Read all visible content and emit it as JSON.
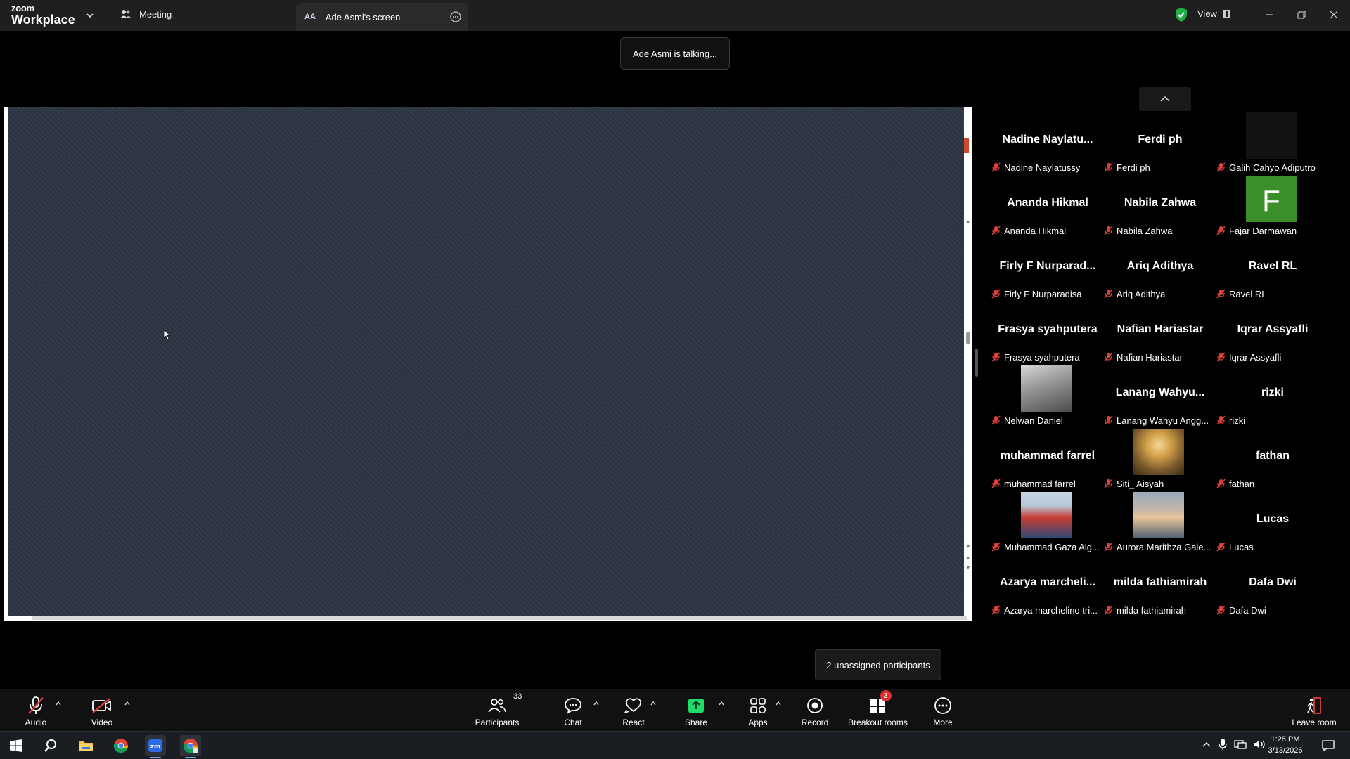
{
  "app": {
    "brand_line1": "zoom",
    "brand_line2": "Workplace",
    "tabs": [
      {
        "label": "Meeting"
      },
      {
        "label": "Ade Asmi's screen",
        "badge": "AA"
      }
    ],
    "view_label": "View"
  },
  "status": {
    "talking": "Ade Asmi is talking...",
    "unassigned": "2 unassigned participants"
  },
  "participants": [
    {
      "big": "Nadine  Naylatu...",
      "name": "Nadine Naylatussy",
      "muted": true
    },
    {
      "big": "Ferdi ph",
      "name": "Ferdi ph",
      "muted": true
    },
    {
      "big": "",
      "name": "Galih Cahyo Adiputro",
      "muted": true,
      "thumb": "dark"
    },
    {
      "big": "Ananda Hikmal",
      "name": "Ananda Hikmal",
      "muted": true
    },
    {
      "big": "Nabila Zahwa",
      "name": "Nabila Zahwa",
      "muted": true
    },
    {
      "big": "",
      "name": "Fajar Darmawan",
      "muted": true,
      "thumb": "avatar",
      "initial": "F"
    },
    {
      "big": "Firly  F  Nurparad...",
      "name": "Firly F Nurparadisa",
      "muted": true
    },
    {
      "big": "Ariq Adithya",
      "name": "Ariq Adithya",
      "muted": true
    },
    {
      "big": "Ravel RL",
      "name": "Ravel RL",
      "muted": true
    },
    {
      "big": "Frasya syahputera",
      "name": "Frasya syahputera",
      "muted": true
    },
    {
      "big": "Nafian Hariastar",
      "name": "Nafian Hariastar",
      "muted": true
    },
    {
      "big": "Iqrar Assyafli",
      "name": "Iqrar Assyafli",
      "muted": true
    },
    {
      "big": "",
      "name": "Nelwan Daniel",
      "muted": true,
      "thumb": "photo-gray"
    },
    {
      "big": "Lanang  Wahyu...",
      "name": "Lanang Wahyu Angg...",
      "muted": true
    },
    {
      "big": "rizki",
      "name": "rizki",
      "muted": true
    },
    {
      "big": "muhammad farrel",
      "name": "muhammad farrel",
      "muted": true
    },
    {
      "big": "",
      "name": "Siti_ Aisyah",
      "muted": true,
      "thumb": "photo-sunset"
    },
    {
      "big": "fathan",
      "name": "fathan",
      "muted": true
    },
    {
      "big": "",
      "name": "Muhammad Gaza Alg...",
      "muted": true,
      "thumb": "photo-person"
    },
    {
      "big": "",
      "name": "Aurora Marithza Gale...",
      "muted": true,
      "thumb": "photo-sky"
    },
    {
      "big": "Lucas",
      "name": "Lucas",
      "muted": true
    },
    {
      "big": "Azarya  marcheli...",
      "name": "Azarya marchelino tri...",
      "muted": true
    },
    {
      "big": "milda fathiamirah",
      "name": "milda fathiamirah",
      "muted": true
    },
    {
      "big": "Dafa Dwi",
      "name": "Dafa Dwi",
      "muted": true
    }
  ],
  "toolbar": {
    "audio": "Audio",
    "video": "Video",
    "participants": "Participants",
    "participants_count": "33",
    "chat": "Chat",
    "react": "React",
    "share": "Share",
    "apps": "Apps",
    "record": "Record",
    "breakout": "Breakout rooms",
    "breakout_badge": "2",
    "more": "More",
    "leave": "Leave room"
  },
  "taskbar": {
    "time": "1:28 PM",
    "date": "3/13/2026"
  },
  "colors": {
    "accent_green": "#1fdc6a",
    "muted_red": "#e0403a",
    "badge_red": "#e02f2f",
    "avatar_green": "#3a8f2a"
  }
}
